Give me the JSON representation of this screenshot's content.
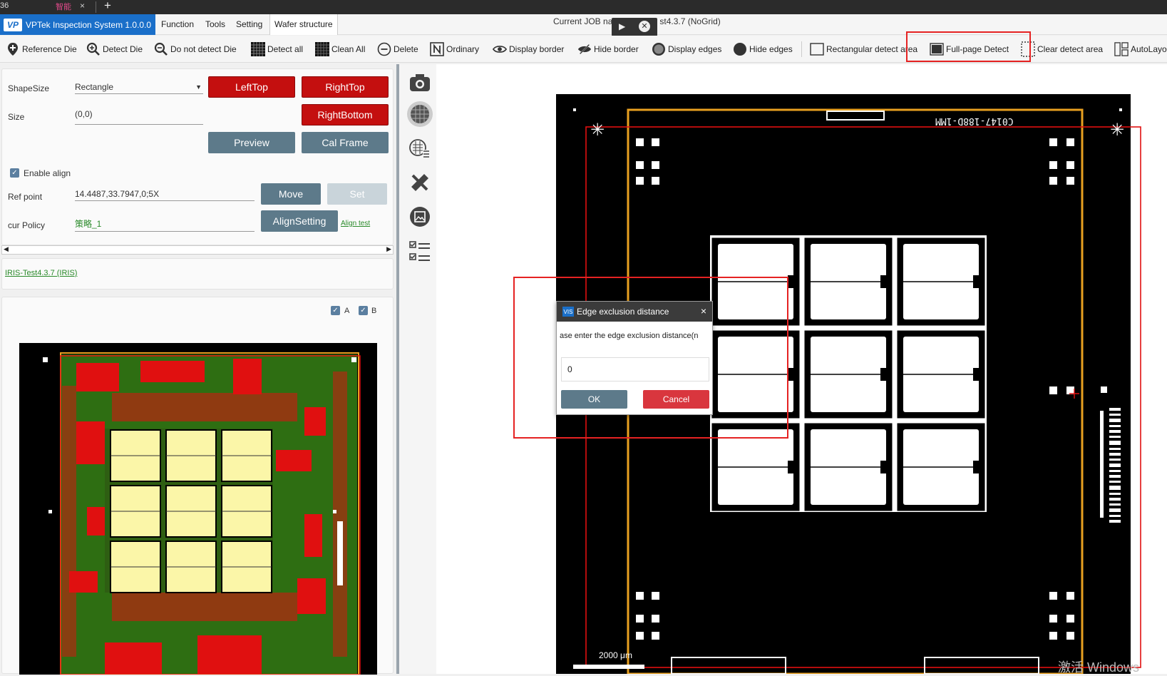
{
  "tabstrip": {
    "left_text": "36",
    "tab_label": "智能",
    "close": "×",
    "new_tab": "+"
  },
  "app": {
    "logo": "VP",
    "title": "VPTek Inspection System 1.0.0.0"
  },
  "menu": {
    "function": "Function",
    "tools": "Tools",
    "setting": "Setting",
    "wafer_structure": "Wafer structure"
  },
  "job": {
    "label_left": "Current JOB na",
    "label_right": "st4.3.7 (NoGrid)"
  },
  "toolbar": {
    "reference_die": "Reference Die",
    "detect_die": "Detect Die",
    "do_not_detect_die": "Do not detect Die",
    "detect_all": "Detect all",
    "clean_all": "Clean All",
    "delete": "Delete",
    "ordinary": "Ordinary",
    "display_border": "Display border",
    "hide_border": "Hide border",
    "display_edges": "Display edges",
    "hide_edges": "Hide edges",
    "rect_detect_area": "Rectangular detect area",
    "full_page_detect": "Full-page Detect",
    "clear_detect_area": "Clear detect area",
    "auto_layout": "AutoLayo"
  },
  "panel": {
    "shapesize_label": "ShapeSize",
    "shapesize_value": "Rectangle",
    "size_label": "Size",
    "size_value": "(0,0)",
    "lefttop": "LeftTop",
    "righttop": "RightTop",
    "rightbottom": "RightBottom",
    "preview": "Preview",
    "cal_frame": "Cal Frame",
    "enable_align": "Enable align",
    "ref_point_label": "Ref point",
    "ref_point_value": "14.4487,33.7947,0;5X",
    "move": "Move",
    "set": "Set",
    "cur_policy_label": "cur Policy",
    "cur_policy_value": "策略_1",
    "align_setting": "AlignSetting",
    "align_test": "Align test",
    "recipe_link": "IRIS-Test4.3.7 (IRIS)",
    "cb_a": "A",
    "cb_b": "B",
    "check": "✓"
  },
  "canvas": {
    "chip_text": "C0147-188D-1MM",
    "scale_label": "2000 μm",
    "watermark": "激活 Windows"
  },
  "dialog": {
    "title": "Edge exclusion distance",
    "icon": "VIS",
    "close": "×",
    "prompt": "ase enter the edge exclusion distance(n",
    "value": "0",
    "ok": "OK",
    "cancel": "Cancel"
  },
  "colors": {
    "brand_blue": "#1a6fc9",
    "danger_red": "#c40f0f",
    "highlight_red": "#e52222",
    "gray_btn": "#5d7a8a"
  }
}
